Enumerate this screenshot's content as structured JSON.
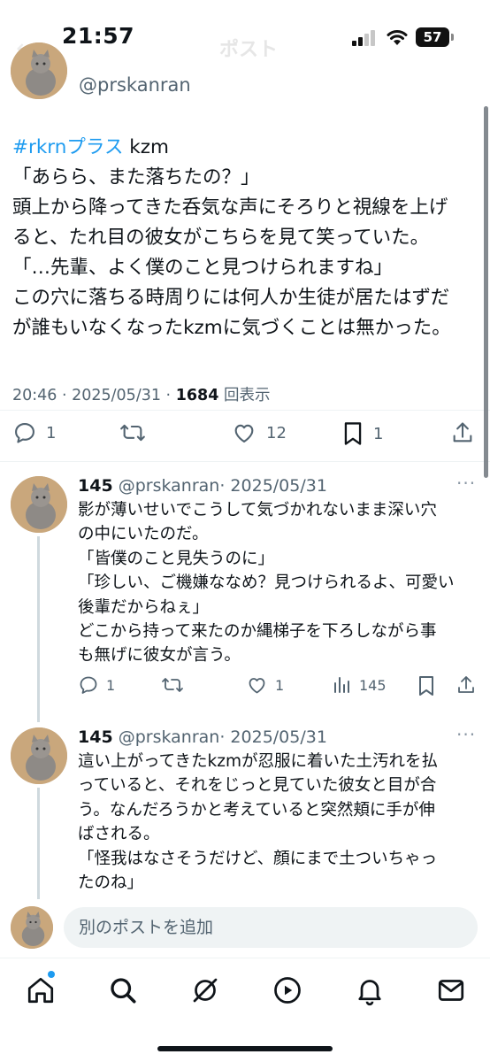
{
  "status_bar": {
    "time": "21:57",
    "battery": "57"
  },
  "header": {
    "title": "ポスト"
  },
  "main_post": {
    "handle": "@prskanran",
    "hashtag": "#rkrnプラス",
    "first_line_rest": " kzm",
    "lines": [
      "「あらら、また落ちたの？」",
      "頭上から降ってきた呑気な声にそろりと視線を上げ",
      "ると、たれ目の彼女がこちらを見て笑っていた。",
      "「…先輩、よく僕のこと見つけられますね」",
      "この穴に落ちる時周りには何人か生徒が居たはずだ",
      "が誰もいなくなったkzmに気づくことは無かった。"
    ],
    "timestamp": "20:46 · 2025/05/31 · ",
    "views_count": "1684",
    "views_label": " 回表示",
    "replies": "1",
    "reposts": "",
    "likes": "12",
    "bookmarks": "1"
  },
  "replies": [
    {
      "name": "145",
      "handle": "@prskanran",
      "date": "· 2025/05/31",
      "lines": [
        "影が薄いせいでこうして気づかれないまま深い穴",
        "の中にいたのだ。",
        "「皆僕のこと見失うのに」",
        "「珍しい、ご機嫌ななめ？見つけられるよ、可愛い",
        "後輩だからねぇ」",
        "どこから持って来たのか縄梯子を下ろしながら事",
        "も無げに彼女が言う。"
      ],
      "replies": "1",
      "likes": "1",
      "views": "145"
    },
    {
      "name": "145",
      "handle": "@prskanran",
      "date": "· 2025/05/31",
      "lines": [
        "這い上がってきたkzmが忍服に着いた土汚れを払",
        "っていると、それをじっと見ていた彼女と目が合",
        "う。なんだろうかと考えていると突然頬に手が伸",
        "ばされる。",
        "「怪我はなさそうだけど、顔にまで土ついちゃっ",
        "たのね」"
      ]
    }
  ],
  "composer": {
    "placeholder": "別のポストを追加"
  },
  "nav": {
    "items": [
      "home-icon",
      "search-icon",
      "grok-icon",
      "video-icon",
      "notifications-icon",
      "messages-icon"
    ]
  },
  "colors": {
    "accent": "#1d9bf0",
    "secondary_text": "#536471",
    "primary_text": "#0f1419"
  }
}
